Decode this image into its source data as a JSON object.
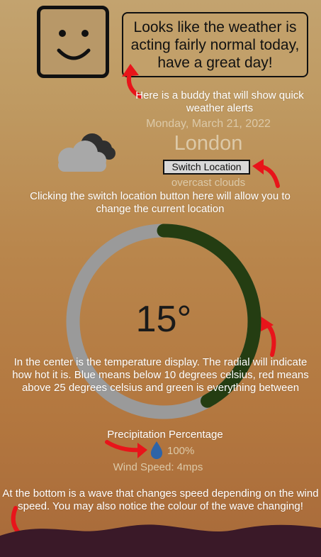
{
  "buddy": {
    "message": "Looks like the weather is acting fairly normal today, have a great day!"
  },
  "notes": {
    "buddy": "Here is a buddy that will show quick weather alerts",
    "switch": "Clicking the switch location button here will allow you to change the current location",
    "temperature": "In the center is the temperature display. The radial will indicate how hot it is. Blue means below 10 degrees celsius, red means above 25 degrees celsius and green is everything between",
    "wave": "At the bottom is a wave that changes speed depending on the wind speed. You may also notice the colour of the wave changing!"
  },
  "weather": {
    "date": "Monday, March 21, 2022",
    "city": "London",
    "switch_label": "Switch Location",
    "condition": "overcast clouds",
    "condition_icon": "cloud-icon",
    "temperature": "15°",
    "temperature_fraction": 0.42,
    "gauge_color": "#243d12",
    "gauge_track_color": "#9a9a9a",
    "precip_title": "Precipitation Percentage",
    "precip_value": "100%",
    "wind": "Wind Speed: 4mps"
  },
  "colors": {
    "wave": "#3a1928",
    "arrow": "#e8141a"
  }
}
